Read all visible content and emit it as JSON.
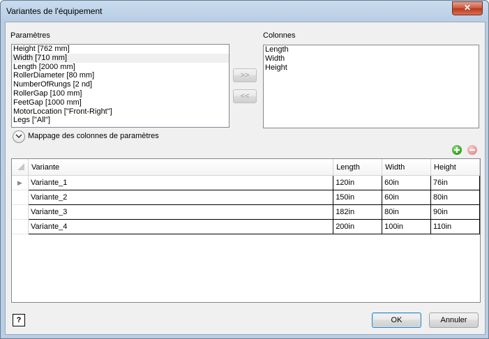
{
  "window": {
    "title": "Variantes de l'équipement",
    "close_label": "✕"
  },
  "parametres": {
    "label": "Paramètres",
    "items": [
      "Height [762 mm]",
      "Width [710 mm]",
      "Length [2000 mm]",
      "RollerDiameter [80 mm]",
      "NumberOfRungs [2 nd]",
      "RollerGap [100 mm]",
      "FeetGap [1000 mm]",
      "MotorLocation [\"Front-Right\"]",
      "Legs [\"All\"]"
    ],
    "selected_index": 1
  },
  "move_buttons": {
    "add": ">>",
    "remove": "<<"
  },
  "colonnes": {
    "label": "Colonnes",
    "items": [
      "Length",
      "Width",
      "Height"
    ]
  },
  "mapping": {
    "label": "Mappage des colonnes de paramètres"
  },
  "grid": {
    "headers": [
      "Variante",
      "Length",
      "Width",
      "Height"
    ],
    "rows": [
      [
        "Variante_1",
        "120in",
        "60in",
        "76in"
      ],
      [
        "Variante_2",
        "150in",
        "60in",
        "80in"
      ],
      [
        "Variante_3",
        "182in",
        "80in",
        "90in"
      ],
      [
        "Variante_4",
        "200in",
        "100in",
        "110in"
      ]
    ],
    "current_row_marker": "▶"
  },
  "footer": {
    "ok": "OK",
    "cancel": "Annuler",
    "help": "?"
  },
  "colors": {
    "add_icon": "#3aa528",
    "remove_icon": "#e89a9a"
  }
}
